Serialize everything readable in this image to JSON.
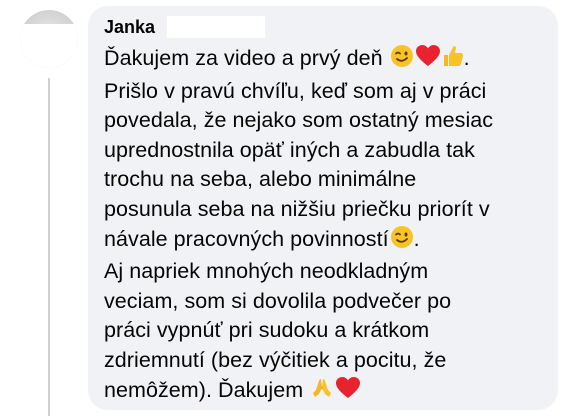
{
  "comment": {
    "author": "Janka",
    "lines": [
      "Ďakujem za video a prvý deň",
      "Prišlo v pravú chvíľu, keď som aj v práci",
      "povedala, že nejako som ostatný mesiac",
      "uprednostnila opäť iných a zabudla tak",
      "trochu na seba, alebo minimálne",
      "posunula seba na nižšiu priečku priorít v",
      "návale pracovných povinností",
      "Aj napriek mnohých neodkladným",
      "veciam, som si dovolila podvečer po",
      "práci vypnúť pri sudoku a krátkom",
      "zdriemnutí (bez výčitiek a pocitu, že",
      "nemôžem). Ďakujem"
    ],
    "line1_suffix": ".",
    "emojis": [
      "winking-face",
      "red-heart",
      "thumbs-up",
      "folded-hands"
    ]
  }
}
